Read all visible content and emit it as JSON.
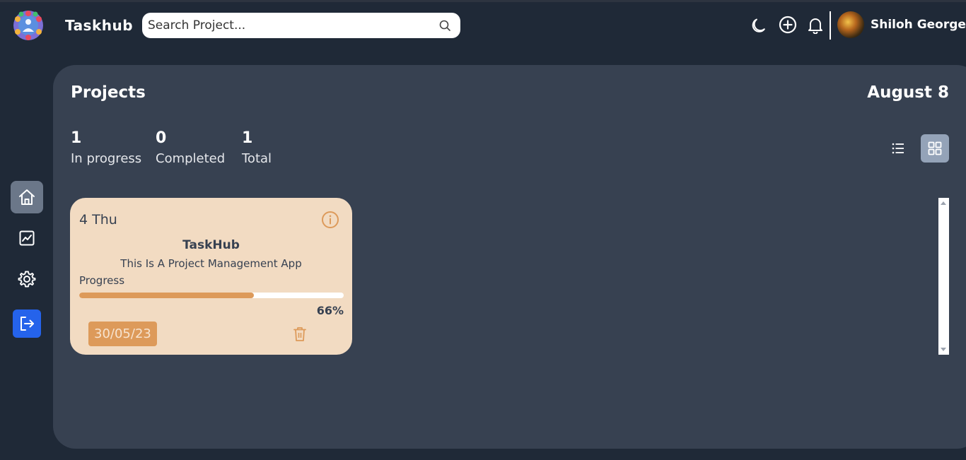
{
  "app": {
    "name": "Taskhub"
  },
  "header": {
    "search_placeholder": "Search Project...",
    "user_name": "Shiloh George",
    "icons": [
      "moon-icon",
      "plus-circle-icon",
      "bell-icon"
    ]
  },
  "sidebar": {
    "items": [
      {
        "name": "home",
        "icon": "home-icon",
        "active": true
      },
      {
        "name": "analytics",
        "icon": "chart-icon",
        "active": false
      },
      {
        "name": "settings",
        "icon": "gear-icon",
        "active": false
      },
      {
        "name": "logout",
        "icon": "logout-icon",
        "active": false
      }
    ]
  },
  "main": {
    "title": "Projects",
    "date": "August 8",
    "stats": [
      {
        "value": "1",
        "label": "In progress"
      },
      {
        "value": "0",
        "label": "Completed"
      },
      {
        "value": "1",
        "label": "Total"
      }
    ],
    "view": "grid"
  },
  "projects": [
    {
      "day": "4 Thu",
      "name": "TaskHub",
      "description": "This Is A Project Management App",
      "progress_label": "Progress",
      "progress": 66,
      "progress_text": "66%",
      "due": "30/05/23"
    }
  ],
  "colors": {
    "background": "#1f2937",
    "panel": "#374151",
    "card": "#f2dbc2",
    "accent": "#dd9a5a",
    "logout": "#2563eb"
  }
}
